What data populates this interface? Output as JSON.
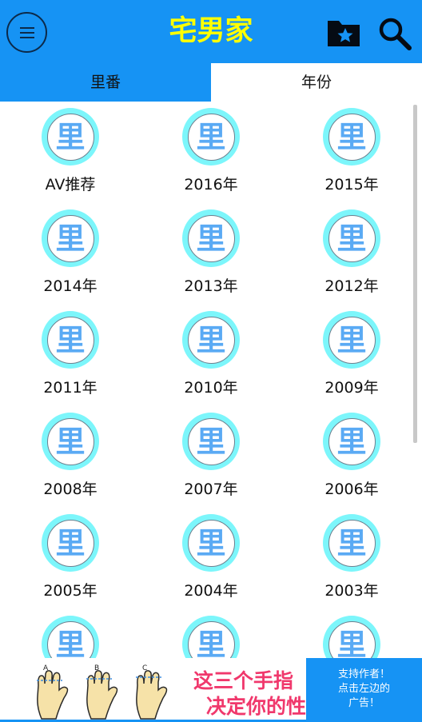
{
  "app": {
    "title": "宅男家",
    "title_color": "#ffff00",
    "bar_color": "#1693f4"
  },
  "toolbar": {
    "menu_icon": "hamburger-menu-icon",
    "favorites_icon": "folder-star-icon",
    "search_icon": "search-icon"
  },
  "tabs": [
    {
      "label": "里番",
      "selected": false
    },
    {
      "label": "年份",
      "selected": true
    }
  ],
  "grid": {
    "icon_char": "里",
    "items": [
      {
        "label": "AV推荐"
      },
      {
        "label": "2016年"
      },
      {
        "label": "2015年"
      },
      {
        "label": "2014年"
      },
      {
        "label": "2013年"
      },
      {
        "label": "2012年"
      },
      {
        "label": "2011年"
      },
      {
        "label": "2010年"
      },
      {
        "label": "2009年"
      },
      {
        "label": "2008年"
      },
      {
        "label": "2007年"
      },
      {
        "label": "2006年"
      },
      {
        "label": "2005年"
      },
      {
        "label": "2004年"
      },
      {
        "label": "2003年"
      },
      {
        "label": ""
      },
      {
        "label": ""
      },
      {
        "label": ""
      }
    ]
  },
  "ad": {
    "letters": [
      "A",
      "B",
      "C"
    ],
    "line1": "这三个手指",
    "line2": "决定你的性",
    "text_color": "#f0386c"
  },
  "support": {
    "line1": "支持作者！",
    "line2": "点击左边的",
    "line3": "广告！"
  }
}
